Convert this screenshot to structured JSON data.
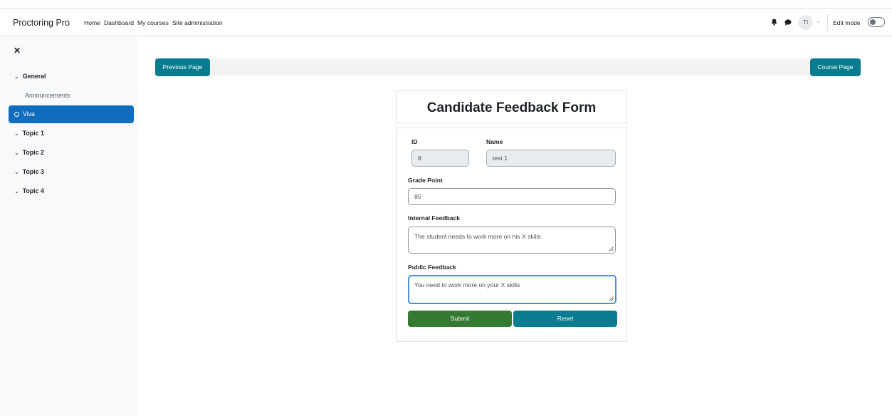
{
  "header": {
    "brand": "Proctoring Pro",
    "nav": [
      "Home",
      "Dashboard",
      "My courses",
      "Site administration"
    ],
    "avatar_initials": "TI",
    "edit_mode_label": "Edit mode"
  },
  "sidebar": {
    "sections": [
      {
        "label": "General",
        "expanded": true
      },
      {
        "label": "Topic 1"
      },
      {
        "label": "Topic 2"
      },
      {
        "label": "Topic 3"
      },
      {
        "label": "Topic 4"
      }
    ],
    "items": [
      {
        "label": "Announcements",
        "active": false
      },
      {
        "label": "Viva",
        "active": true
      }
    ]
  },
  "page_nav": {
    "previous_label": "Previous Page",
    "course_label": "Course Page"
  },
  "form": {
    "title": "Candidate Feedback Form",
    "id_label": "ID",
    "id_value": "8",
    "name_label": "Name",
    "name_value": "test 1",
    "grade_label": "Grade Point",
    "grade_value": "85",
    "internal_label": "Internal Feedback",
    "internal_value": "The student needs to work more on his X skills",
    "public_label": "Public Feedback",
    "public_value": "You need to work more on your X skills",
    "submit_label": "Submit",
    "reset_label": "Reset"
  },
  "colors": {
    "accent_teal": "#0a7c8f",
    "active_blue": "#0f6cbf",
    "submit_green": "#357a32"
  }
}
